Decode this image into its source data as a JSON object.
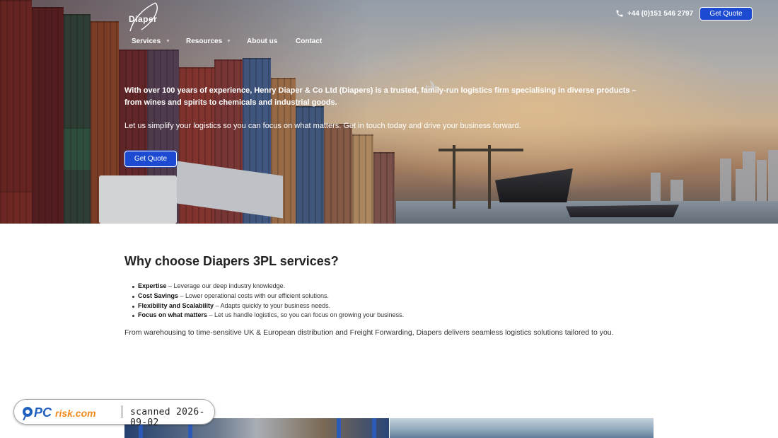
{
  "header": {
    "logo_text": "Diaper",
    "phone": "+44 (0)151 546 2797",
    "quote_button": "Get Quote"
  },
  "nav": {
    "items": [
      {
        "label": "Services",
        "has_dropdown": true
      },
      {
        "label": "Resources",
        "has_dropdown": true
      },
      {
        "label": "About us",
        "has_dropdown": false
      },
      {
        "label": "Contact",
        "has_dropdown": false
      }
    ]
  },
  "hero": {
    "lead": "With over 100 years of experience, Henry Diaper & Co Ltd (Diapers) is a trusted, family-run logistics firm specialising in diverse products – from wines and spirits to chemicals and industrial goods.",
    "sub": "Let us simplify your logistics so you can focus on what matters. Get in touch today and drive your business forward.",
    "button": "Get Quote"
  },
  "why": {
    "title": "Why choose Diapers 3PL services?",
    "points": [
      {
        "term": "Expertise",
        "desc": " – Leverage our deep industry knowledge."
      },
      {
        "term": "Cost Savings",
        "desc": " – Lower operational costs with our efficient solutions."
      },
      {
        "term": "Flexibility and Scalability",
        "desc": " – Adapts quickly to your business needs."
      },
      {
        "term": "Focus on what matters",
        "desc": " – Let us handle logistics, so you can focus on growing your business."
      }
    ],
    "summary": "From warehousing to time-sensitive UK & European distribution and Freight Forwarding, Diapers delivers seamless logistics solutions tailored to you."
  },
  "watermark": {
    "brand": "PCrisk.com",
    "scan_text": "scanned 2026-09-02"
  },
  "icons": {
    "phone": "phone-icon",
    "logo": "diaper-logo-icon",
    "dropdown": "chevron-down-icon"
  },
  "colors": {
    "accent": "#1c4bd1",
    "watermark_blue": "#1f5fbf",
    "watermark_orange": "#f08a1c"
  }
}
